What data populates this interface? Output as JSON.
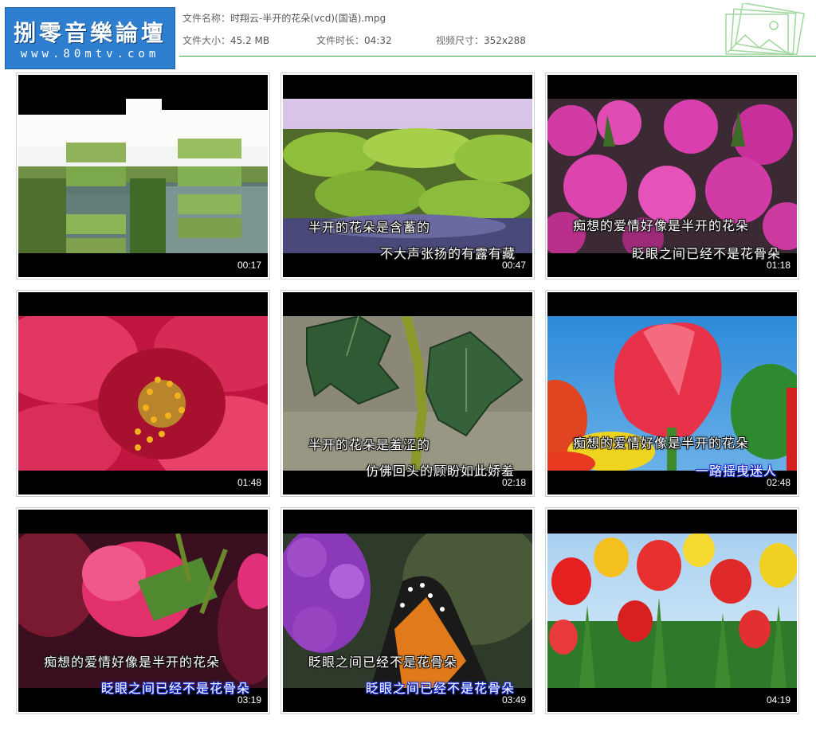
{
  "header": {
    "logo_title": "捌零音樂論壇",
    "logo_url": "www.80mtv.com",
    "file_name_label": "文件名称：",
    "file_name": "时翔云-半开的花朵(vcd)(国语).mpg",
    "file_size_label": "文件大小：",
    "file_size": "45.2 MB",
    "duration_label": "文件时长：",
    "duration": "04:32",
    "resolution_label": "视频尺寸：",
    "resolution": "352x288"
  },
  "thumbnails": [
    {
      "time": "00:17",
      "sub1": "",
      "sub2": ""
    },
    {
      "time": "00:47",
      "sub1": "半开的花朵是含蓄的",
      "sub2": "不大声张扬的有露有藏"
    },
    {
      "time": "01:18",
      "sub1": "痴想的爱情好像是半开的花朵",
      "sub2": "眨眼之间已经不是花骨朵"
    },
    {
      "time": "01:48",
      "sub1": "",
      "sub2": ""
    },
    {
      "time": "02:18",
      "sub1": "半开的花朵是羞涩的",
      "sub2": "仿佛回头的顾盼如此娇羞"
    },
    {
      "time": "02:48",
      "sub1": "痴想的爱情好像是半开的花朵",
      "sub2": "一路摇曳迷人"
    },
    {
      "time": "03:19",
      "sub1": "痴想的爱情好像是半开的花朵",
      "sub2": "眨眼之间已经不是花骨朵"
    },
    {
      "time": "03:49",
      "sub1": "眨眼之间已经不是花骨朵",
      "sub2": "眨眼之间已经不是花骨朵"
    },
    {
      "time": "04:19",
      "sub1": "",
      "sub2": ""
    }
  ],
  "colors": {
    "accent_line": "#3aa84a",
    "logo_bg": "#2f7fd0"
  }
}
